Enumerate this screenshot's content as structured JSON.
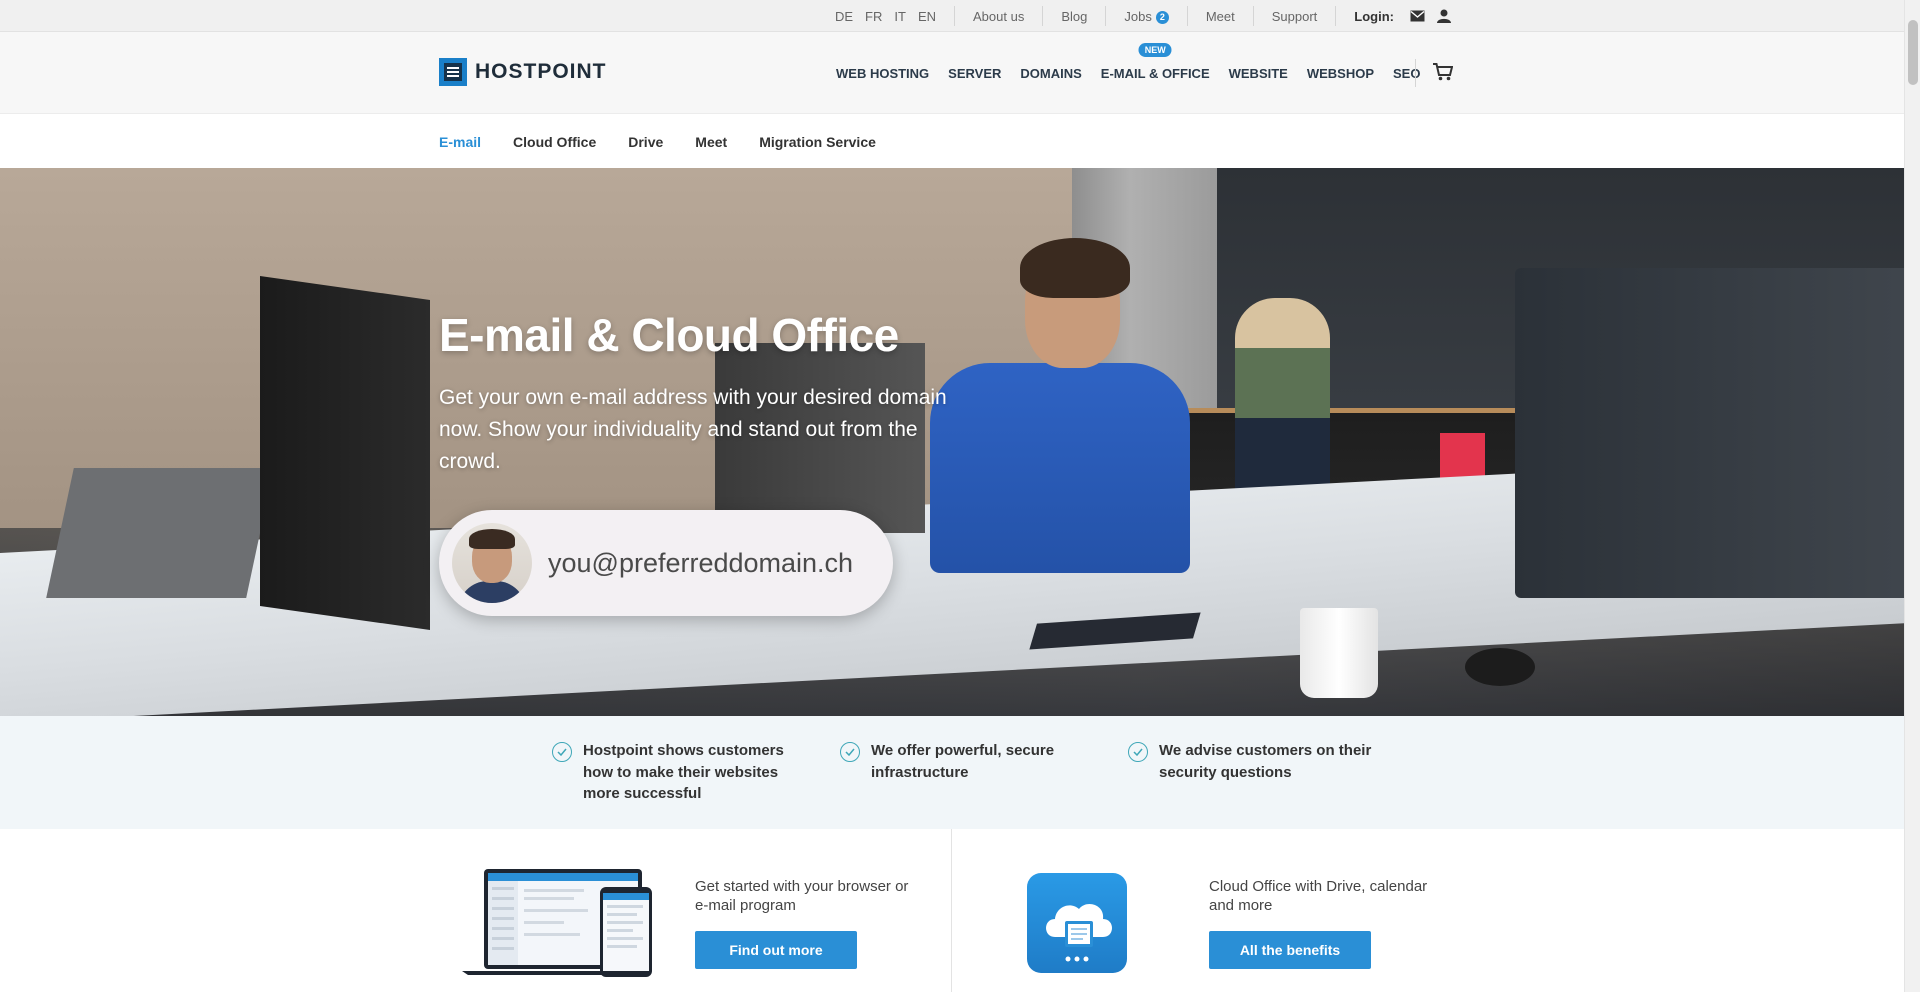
{
  "topbar": {
    "languages": [
      "DE",
      "FR",
      "IT",
      "EN"
    ],
    "links": [
      "About us",
      "Blog",
      "Jobs",
      "Meet",
      "Support"
    ],
    "jobs_badge": "2",
    "login_label": "Login:"
  },
  "header": {
    "logo_text": "HOSTPOINT",
    "nav": [
      "WEB HOSTING",
      "SERVER",
      "DOMAINS",
      "E-MAIL & OFFICE",
      "WEBSITE",
      "WEBSHOP",
      "SEO"
    ],
    "new_tag": "NEW"
  },
  "subnav": [
    "E-mail",
    "Cloud Office",
    "Drive",
    "Meet",
    "Migration Service"
  ],
  "hero": {
    "title": "E-mail & Cloud Office",
    "subtitle": "Get your own e-mail address with your desired domain now. Show your individuality and stand out from the crowd.",
    "email_example": "you@preferreddomain.ch"
  },
  "benefits": [
    "Hostpoint shows customers how to make their websites more successful",
    "We offer powerful, secure infrastructure",
    "We advise customers on their security questions"
  ],
  "offers": [
    {
      "text": "Get started with your browser or e-mail program",
      "button": "Find out more"
    },
    {
      "text": "Cloud Office with Drive, calendar and more",
      "button": "All the benefits"
    }
  ],
  "colors": {
    "accent": "#2a8fd6",
    "check": "#3fa7b8"
  }
}
